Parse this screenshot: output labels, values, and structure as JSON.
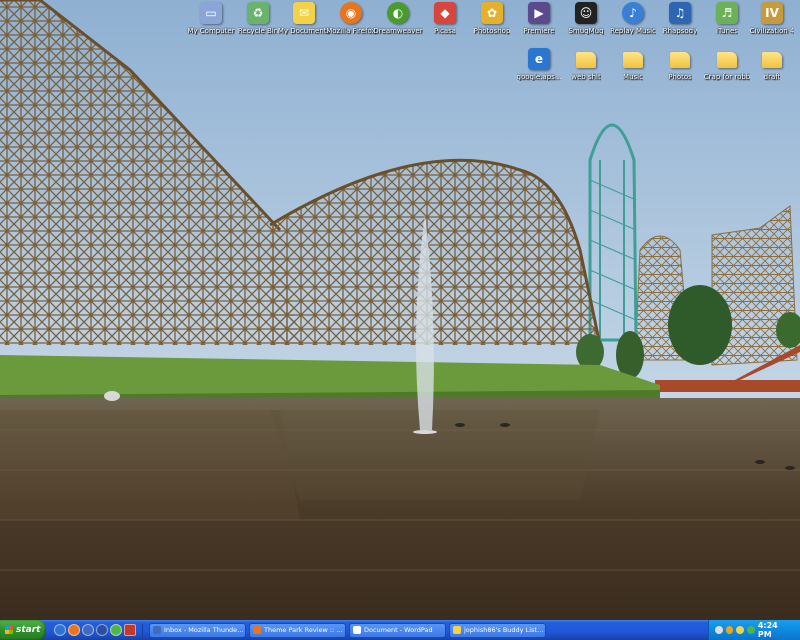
{
  "desktop": {
    "icons_row1": [
      {
        "label": "My Computer",
        "icon": "computer-icon",
        "color": "#8aa6d6"
      },
      {
        "label": "Recycle Bin",
        "icon": "recycle-bin-icon",
        "color": "#6ab36c"
      },
      {
        "label": "My Documents",
        "icon": "documents-folder-icon",
        "color": "#f3d24a"
      },
      {
        "label": "Mozilla Firefox",
        "icon": "firefox-icon",
        "color": "#e8741d"
      },
      {
        "label": "Dreamweaver",
        "icon": "dreamweaver-icon",
        "color": "#4a9b2e"
      },
      {
        "label": "Picasa",
        "icon": "picasa-icon",
        "color": "#d7453d"
      },
      {
        "label": "Photoshop",
        "icon": "photoshop-icon",
        "color": "#e5b12c"
      },
      {
        "label": "Premiere",
        "icon": "premiere-icon",
        "color": "#5b4a8e"
      },
      {
        "label": "SmugMug",
        "icon": "smugmug-icon",
        "color": "#222222"
      },
      {
        "label": "Replay Music",
        "icon": "replay-music-icon",
        "color": "#3a7fd6"
      },
      {
        "label": "Rhapsody",
        "icon": "rhapsody-icon",
        "color": "#2f66b3"
      },
      {
        "label": "iTunes",
        "icon": "itunes-icon",
        "color": "#6db05a"
      },
      {
        "label": "Civilization 4",
        "icon": "civilization-icon",
        "color": "#c79a3b"
      }
    ],
    "icons_row2": [
      {
        "label": "google.aps...",
        "icon": "ie-shortcut-icon",
        "color": "#2b76d0"
      },
      {
        "label": "web shit",
        "icon": "folder-icon",
        "color": "#f3d24a"
      },
      {
        "label": "Music",
        "icon": "folder-icon",
        "color": "#f3d24a"
      },
      {
        "label": "Photos",
        "icon": "folder-icon",
        "color": "#f3d24a"
      },
      {
        "label": "Crap for robb",
        "icon": "folder-icon",
        "color": "#f3d24a"
      },
      {
        "label": "draft",
        "icon": "folder-icon",
        "color": "#f3d24a"
      }
    ]
  },
  "taskbar": {
    "start_label": "start",
    "quick_launch": [
      {
        "icon": "ie-icon",
        "color": "#2b76d0"
      },
      {
        "icon": "firefox-icon",
        "color": "#e8741d"
      },
      {
        "icon": "thunderbird-icon",
        "color": "#3d6bbd"
      },
      {
        "icon": "media-player-icon",
        "color": "#2a4f9e"
      },
      {
        "icon": "messenger-icon",
        "color": "#4fb44a"
      },
      {
        "icon": "filezilla-icon",
        "color": "#c23a2a"
      }
    ],
    "tasks": [
      {
        "label": "Inbox - Mozilla Thunder...",
        "icon": "thunderbird-icon",
        "color": "#3d6bbd"
      },
      {
        "label": "Theme Park Review :: Vi...",
        "icon": "firefox-icon",
        "color": "#e8741d"
      },
      {
        "label": "Document - WordPad",
        "icon": "wordpad-icon",
        "color": "#ffffff"
      },
      {
        "label": "jophish86's Buddy List ...",
        "icon": "aim-icon",
        "color": "#f3d24a"
      }
    ],
    "tray_icons": [
      {
        "icon": "network-icon",
        "color": "#dddddd"
      },
      {
        "icon": "antivirus-icon",
        "color": "#e8a51d"
      },
      {
        "icon": "aim-tray-icon",
        "color": "#f3d24a"
      },
      {
        "icon": "messenger-tray-icon",
        "color": "#4fb44a"
      },
      {
        "icon": "volume-icon",
        "color": "#c8d8f0"
      }
    ],
    "clock": "4:24 PM"
  }
}
